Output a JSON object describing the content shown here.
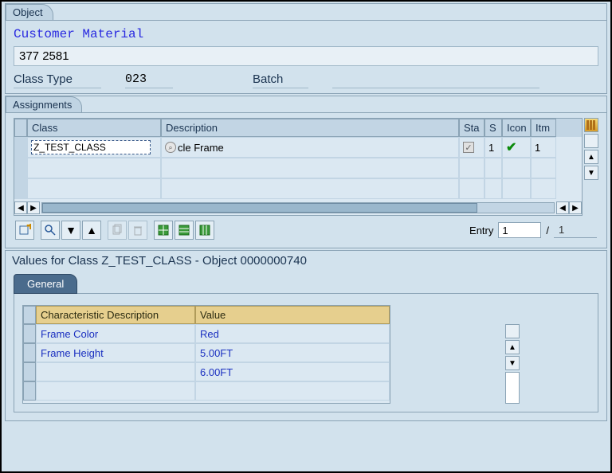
{
  "object": {
    "panel_label": "Object",
    "title": "Customer Material",
    "number": "377      2581",
    "class_type_label": "Class Type",
    "class_type_value": "023",
    "field2_label": "Batch",
    "field2_value": ""
  },
  "assignments": {
    "panel_label": "Assignments",
    "columns": {
      "class": "Class",
      "description": "Description",
      "sta": "Sta",
      "s": "S",
      "icon": "Icon",
      "itm": "Itm"
    },
    "row": {
      "class_value": "Z_TEST_CLASS",
      "description": "cle Frame",
      "status_checked": true,
      "s": "1",
      "itm": "1"
    },
    "entry": {
      "label": "Entry",
      "current": "1",
      "sep": "/",
      "total": "1"
    }
  },
  "toolbar_icons": {
    "new_entry": "new-entry",
    "find": "find",
    "sort_desc": "▼",
    "sort_asc": "▲",
    "copy": "copy",
    "delete": "delete",
    "col1": "col1",
    "col2": "col2",
    "col3": "col3"
  },
  "values": {
    "title": "Values for Class Z_TEST_CLASS - Object 0000000740",
    "tab_general": "General",
    "columns": {
      "chardesc": "Characteristic Description",
      "value": "Value"
    },
    "rows": [
      {
        "desc": "Frame Color",
        "value": "Red"
      },
      {
        "desc": "Frame Height",
        "value": "5.00FT"
      },
      {
        "desc": "",
        "value": "6.00FT"
      }
    ]
  }
}
